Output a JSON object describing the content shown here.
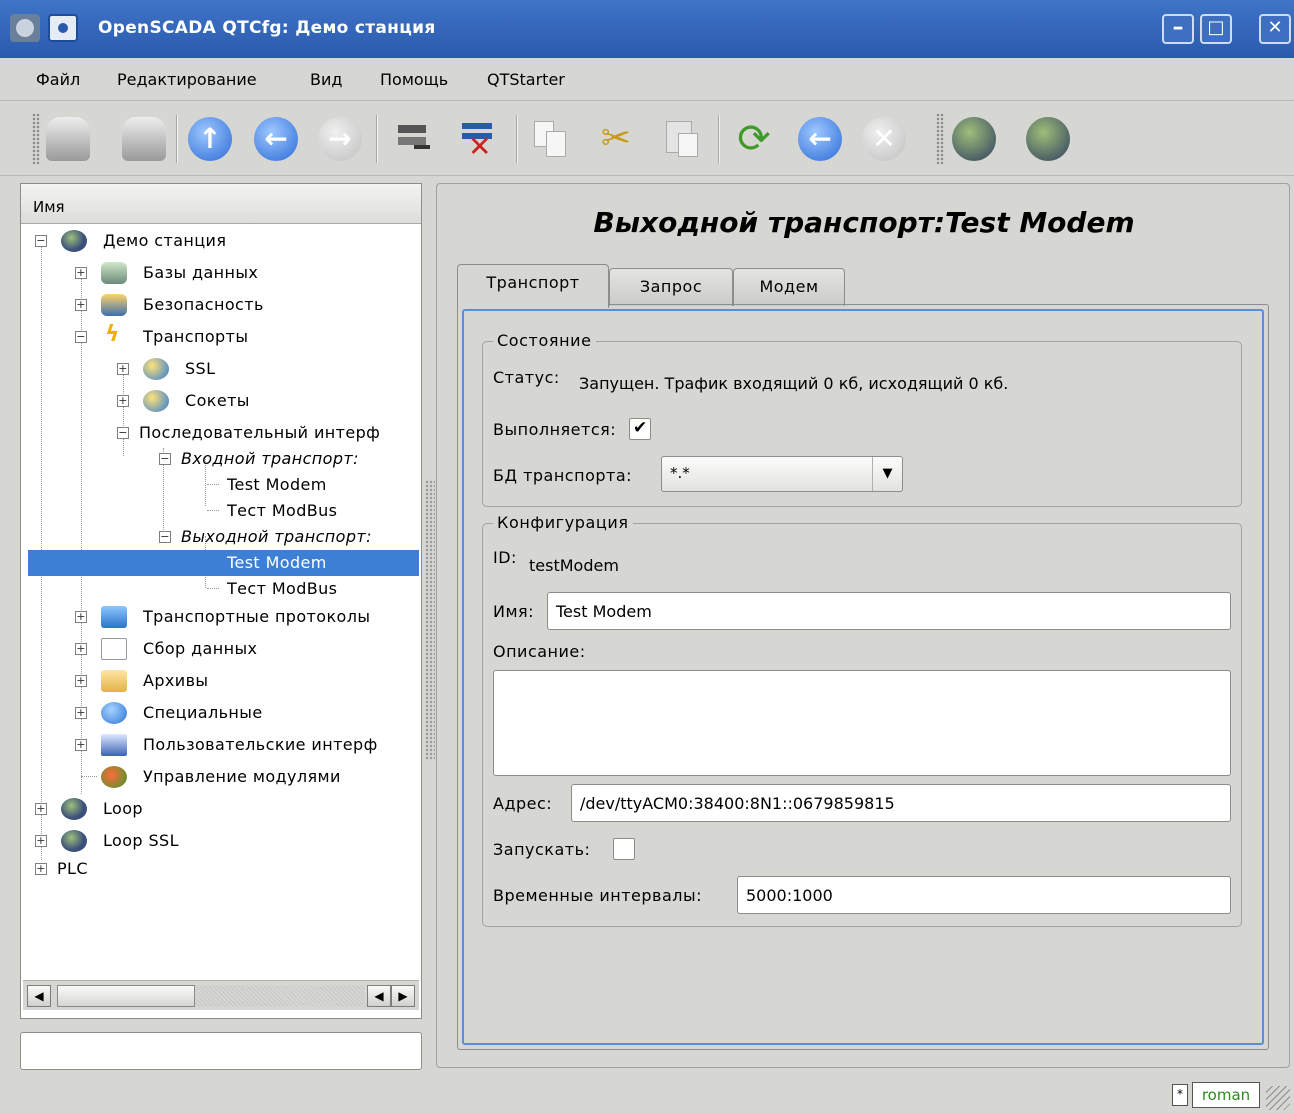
{
  "window": {
    "title": "OpenSCADA QTCfg: Демо станция",
    "controls": {
      "minimize": "–",
      "maximize": "□",
      "close": "✕"
    }
  },
  "menu": {
    "items": [
      "Файл",
      "Редактирование",
      "Вид",
      "Помощь",
      "QTStarter"
    ]
  },
  "toolbar": {
    "icons": [
      "db-load-icon",
      "db-save-icon",
      "up-icon",
      "back-icon",
      "forward-icon",
      "add-item-icon",
      "delete-item-icon",
      "copy-icon",
      "cut-icon",
      "paste-icon",
      "refresh-icon",
      "start-icon",
      "stop-icon",
      "station-config-icon",
      "station-config-2-icon"
    ]
  },
  "tree": {
    "header": "Имя",
    "rows": [
      {
        "label": "Демо станция"
      },
      {
        "label": "Базы данных"
      },
      {
        "label": "Безопасность"
      },
      {
        "label": "Транспорты"
      },
      {
        "label": "SSL"
      },
      {
        "label": "Сокеты"
      },
      {
        "label": "Последовательный интерф"
      },
      {
        "label": "Входной транспорт:"
      },
      {
        "label": "Test Modem"
      },
      {
        "label": "Тест ModBus"
      },
      {
        "label": "Выходной транспорт:"
      },
      {
        "label": "Test Modem"
      },
      {
        "label": "Тест ModBus"
      },
      {
        "label": "Транспортные протоколы"
      },
      {
        "label": "Сбор данных"
      },
      {
        "label": "Архивы"
      },
      {
        "label": "Специальные"
      },
      {
        "label": "Пользовательские интерф"
      },
      {
        "label": "Управление модулями"
      },
      {
        "label": "Loop"
      },
      {
        "label": "Loop SSL"
      },
      {
        "label": "PLC"
      }
    ]
  },
  "main": {
    "title": "Выходной транспорт:Test Modem",
    "tabs": [
      "Транспорт",
      "Запрос",
      "Модем"
    ],
    "active_tab": "Транспорт",
    "state": {
      "group_title": "Состояние",
      "status_label": "Статус:",
      "status_value": "Запущен. Трафик входящий 0 кб, исходящий 0 кб.",
      "running_label": "Выполняется:",
      "running_checked": true,
      "db_label": "БД транспорта:",
      "db_value": "*.*"
    },
    "config": {
      "group_title": "Конфигурация",
      "id_label": "ID:",
      "id_value": "testModem",
      "name_label": "Имя:",
      "name_value": "Test Modem",
      "description_label": "Описание:",
      "description_value": "",
      "address_label": "Адрес:",
      "address_value": "/dev/ttyACM0:38400:8N1::0679859815",
      "autostart_label": "Запускать:",
      "autostart_checked": false,
      "intervals_label": "Временные интервалы:",
      "intervals_value": "5000:1000"
    }
  },
  "statusbar": {
    "flag": "*",
    "user": "roman"
  }
}
